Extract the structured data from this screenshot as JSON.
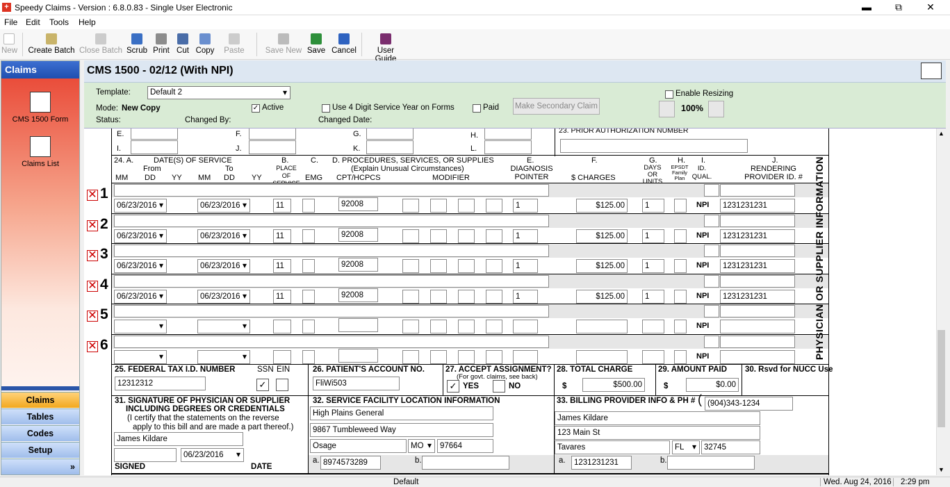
{
  "window": {
    "title": "Speedy Claims - Version : 6.8.0.83 - Single User Electronic",
    "min": "▬",
    "max": "⧉",
    "close": "✕"
  },
  "menu": [
    "File",
    "Edit",
    "Tools",
    "Help"
  ],
  "toolbar": {
    "new": "New",
    "create_batch": "Create Batch",
    "close_batch": "Close Batch",
    "scrub": "Scrub",
    "print": "Print",
    "cut": "Cut",
    "copy": "Copy",
    "paste": "Paste",
    "save_new": "Save New",
    "save": "Save",
    "cancel": "Cancel",
    "user_guide": "User Guide"
  },
  "sidebar": {
    "header": "Claims",
    "items": [
      "CMS 1500 Form",
      "Claims List"
    ],
    "nav": [
      "Claims",
      "Tables",
      "Codes",
      "Setup"
    ],
    "more": "»"
  },
  "form": {
    "title": "CMS 1500 - 02/12  (With NPI)"
  },
  "settings": {
    "template_label": "Template:",
    "template_value": "Default 2",
    "mode_label": "Mode:",
    "mode_value": "New Copy",
    "active": "Active",
    "four_digit": "Use 4 Digit Service Year on Forms",
    "paid": "Paid",
    "secondary": "Make Secondary Claim",
    "enable_resizing": "Enable Resizing",
    "zoom": "100%",
    "status_label": "Status:",
    "changed_by": "Changed By:",
    "changed_date": "Changed Date:"
  },
  "top_letters": {
    "e": "E.",
    "f": "F.",
    "g": "G.",
    "h": "H.",
    "i": "I.",
    "j": "J.",
    "k": "K.",
    "l": "L.",
    "auth": "23. PRIOR AUTHORIZATION NUMBER"
  },
  "headers": {
    "a24": "24.  A.",
    "dates": "DATE(S) OF SERVICE",
    "from": "From",
    "to": "To",
    "mm": "MM",
    "dd": "DD",
    "yy": "YY",
    "b": "B.",
    "place": "PLACE OF SERVICE",
    "c": "C.",
    "emg": "EMG",
    "d": "D. PROCEDURES, SERVICES, OR SUPPLIES",
    "explain": "(Explain Unusual Circumstances)",
    "cpt": "CPT/HCPCS",
    "modifier": "MODIFIER",
    "e": "E.",
    "diag": "DIAGNOSIS POINTER",
    "f": "F.",
    "charges": "$ CHARGES",
    "g": "G.",
    "days": "DAYS OR UNITS",
    "h": "H.",
    "epsdt": "EPSDT Family Plan",
    "i": "I.",
    "idqual": "ID. QUAL.",
    "j": "J.",
    "rendering": "RENDERING PROVIDER ID. #"
  },
  "lines": [
    {
      "n": "1",
      "from": "06/23/2016",
      "to": "06/23/2016",
      "pos": "11",
      "cpt": "92008",
      "ptr": "1",
      "charge": "$125.00",
      "units": "1",
      "npi": "NPI",
      "prov": "1231231231"
    },
    {
      "n": "2",
      "from": "06/23/2016",
      "to": "06/23/2016",
      "pos": "11",
      "cpt": "92008",
      "ptr": "1",
      "charge": "$125.00",
      "units": "1",
      "npi": "NPI",
      "prov": "1231231231"
    },
    {
      "n": "3",
      "from": "06/23/2016",
      "to": "06/23/2016",
      "pos": "11",
      "cpt": "92008",
      "ptr": "1",
      "charge": "$125.00",
      "units": "1",
      "npi": "NPI",
      "prov": "1231231231"
    },
    {
      "n": "4",
      "from": "06/23/2016",
      "to": "06/23/2016",
      "pos": "11",
      "cpt": "92008",
      "ptr": "1",
      "charge": "$125.00",
      "units": "1",
      "npi": "NPI",
      "prov": "1231231231"
    },
    {
      "n": "5",
      "from": "",
      "to": "",
      "pos": "",
      "cpt": "",
      "ptr": "",
      "charge": "",
      "units": "",
      "npi": "NPI",
      "prov": ""
    },
    {
      "n": "6",
      "from": "",
      "to": "",
      "pos": "",
      "cpt": "",
      "ptr": "",
      "charge": "",
      "units": "",
      "npi": "NPI",
      "prov": ""
    }
  ],
  "box25": {
    "label": "25. FEDERAL TAX I.D. NUMBER",
    "ssn": "SSN",
    "ein": "EIN",
    "value": "12312312"
  },
  "box26": {
    "label": "26. PATIENT'S ACCOUNT NO.",
    "value": "FliWi503"
  },
  "box27": {
    "label": "27. ACCEPT ASSIGNMENT?",
    "sub": "(For govt. claims, see back)",
    "yes": "YES",
    "no": "NO"
  },
  "box28": {
    "label": "28. TOTAL CHARGE",
    "dollar": "$",
    "value": "$500.00"
  },
  "box29": {
    "label": "29. AMOUNT PAID",
    "dollar": "$",
    "value": "$0.00"
  },
  "box30": {
    "label": "30. Rsvd for NUCC Use"
  },
  "box31": {
    "l1": "31. SIGNATURE OF PHYSICIAN OR SUPPLIER",
    "l2": "INCLUDING DEGREES OR CREDENTIALS",
    "l3": "(I certify that the statements on the reverse",
    "l4": "apply to this bill and are made a part thereof.)",
    "name": "James Kildare",
    "date": "06/23/2016",
    "signed": "SIGNED",
    "date_lbl": "DATE"
  },
  "box32": {
    "label": "32. SERVICE FACILITY LOCATION INFORMATION",
    "name": "High Plains General",
    "street": "9867 Tumbleweed Way",
    "city": "Osage",
    "state": "MO",
    "zip": "97664",
    "a": "a.",
    "a_val": "8974573289",
    "b": "b."
  },
  "box33": {
    "label": "33. BILLING PROVIDER INFO & PH #",
    "paren": "(",
    "phone": "(904)343-1234",
    "name": "James Kildare",
    "street": "123 Main St",
    "city": "Tavares",
    "state": "FL",
    "zip": "32745",
    "a": "a.",
    "a_val": "1231231231",
    "b": "b."
  },
  "vertical": "PHYSICIAN OR SUPPLIER INFORMATION",
  "status": {
    "center": "Default",
    "date": "Wed.  Aug 24, 2016",
    "time": "2:29 pm"
  }
}
